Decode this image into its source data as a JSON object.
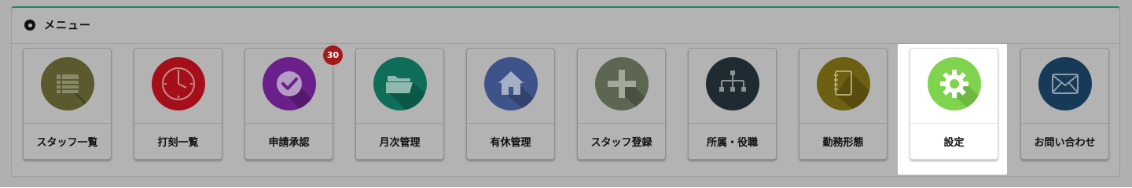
{
  "panel": {
    "title": "メニュー",
    "header_icon": "radio-dot-icon"
  },
  "menu": {
    "items": [
      {
        "label": "スタッフ一覧",
        "icon": "list-icon",
        "color": "#5a5a2e"
      },
      {
        "label": "打刻一覧",
        "icon": "clock-icon",
        "color": "#a50f1a"
      },
      {
        "label": "申請承認",
        "icon": "check-icon",
        "color": "#6a1f8a",
        "badge": "30"
      },
      {
        "label": "月次管理",
        "icon": "folder-icon",
        "color": "#0f6e5a"
      },
      {
        "label": "有休管理",
        "icon": "home-icon",
        "color": "#3e5389"
      },
      {
        "label": "スタッフ登録",
        "icon": "plus-icon",
        "color": "#5c6651"
      },
      {
        "label": "所属・役職",
        "icon": "org-chart-icon",
        "color": "#1e2b33"
      },
      {
        "label": "勤務形態",
        "icon": "notebook-icon",
        "color": "#6e6012"
      },
      {
        "label": "設定",
        "icon": "gear-icon",
        "color": "#7fd34d",
        "active": true
      },
      {
        "label": "お問い合わせ",
        "icon": "mail-icon",
        "color": "#173a58"
      }
    ],
    "badge_color": "#a31818"
  }
}
